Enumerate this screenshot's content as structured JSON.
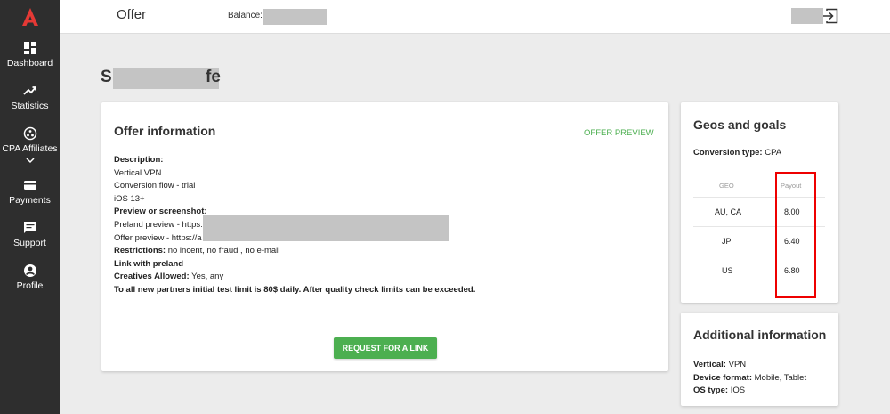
{
  "sidebar": {
    "items": [
      {
        "label": "Dashboard",
        "icon": "dashboard-icon"
      },
      {
        "label": "Statistics",
        "icon": "trending-up-icon"
      },
      {
        "label": "CPA Affiliates",
        "icon": "affiliates-icon"
      },
      {
        "label": "Payments",
        "icon": "credit-card-icon"
      },
      {
        "label": "Support",
        "icon": "chat-icon"
      },
      {
        "label": "Profile",
        "icon": "account-circle-icon"
      }
    ]
  },
  "header": {
    "title": "Offer",
    "balance_label": "Balance:"
  },
  "page": {
    "title_start": "S",
    "title_end": "fe"
  },
  "offer": {
    "title": "Offer information",
    "preview_link": "OFFER PREVIEW",
    "description_label": "Description:",
    "lines": [
      "Vertical VPN",
      "Conversion flow - trial",
      "iOS 13+"
    ],
    "preview_label": "Preview or screenshot:",
    "preland_preview": "Preland preview - https:",
    "offer_preview": "Offer preview - https://a",
    "restrictions_label": "Restrictions:",
    "restrictions_value": " no incent, no fraud , no e-mail",
    "link_with_preland": "Link with preland",
    "creatives_label": "Creatives Allowed:",
    "creatives_value": " Yes, any",
    "limit_note": "To all new partners initial test limit is 80$ daily. After quality check limits can be exceeded.",
    "request_button": "REQUEST FOR A LINK"
  },
  "geos": {
    "title": "Geos and goals",
    "conversion_label": "Conversion type:",
    "conversion_value": " CPA",
    "col_geo": "GEO",
    "col_payout": "Payout",
    "rows": [
      {
        "geo": "AU, CA",
        "payout": "8.00"
      },
      {
        "geo": "JP",
        "payout": "6.40"
      },
      {
        "geo": "US",
        "payout": "6.80"
      }
    ]
  },
  "additional": {
    "title": "Additional information",
    "vertical_label": "Vertical:",
    "vertical_value": " VPN",
    "device_label": "Device format:",
    "device_value": " Mobile, Tablet",
    "os_label": "OS type:",
    "os_value": " IOS"
  },
  "colors": {
    "sidebar_bg": "#2e2e2e",
    "accent": "#4caf50",
    "logo": "#e53935",
    "highlight": "#e00000"
  }
}
